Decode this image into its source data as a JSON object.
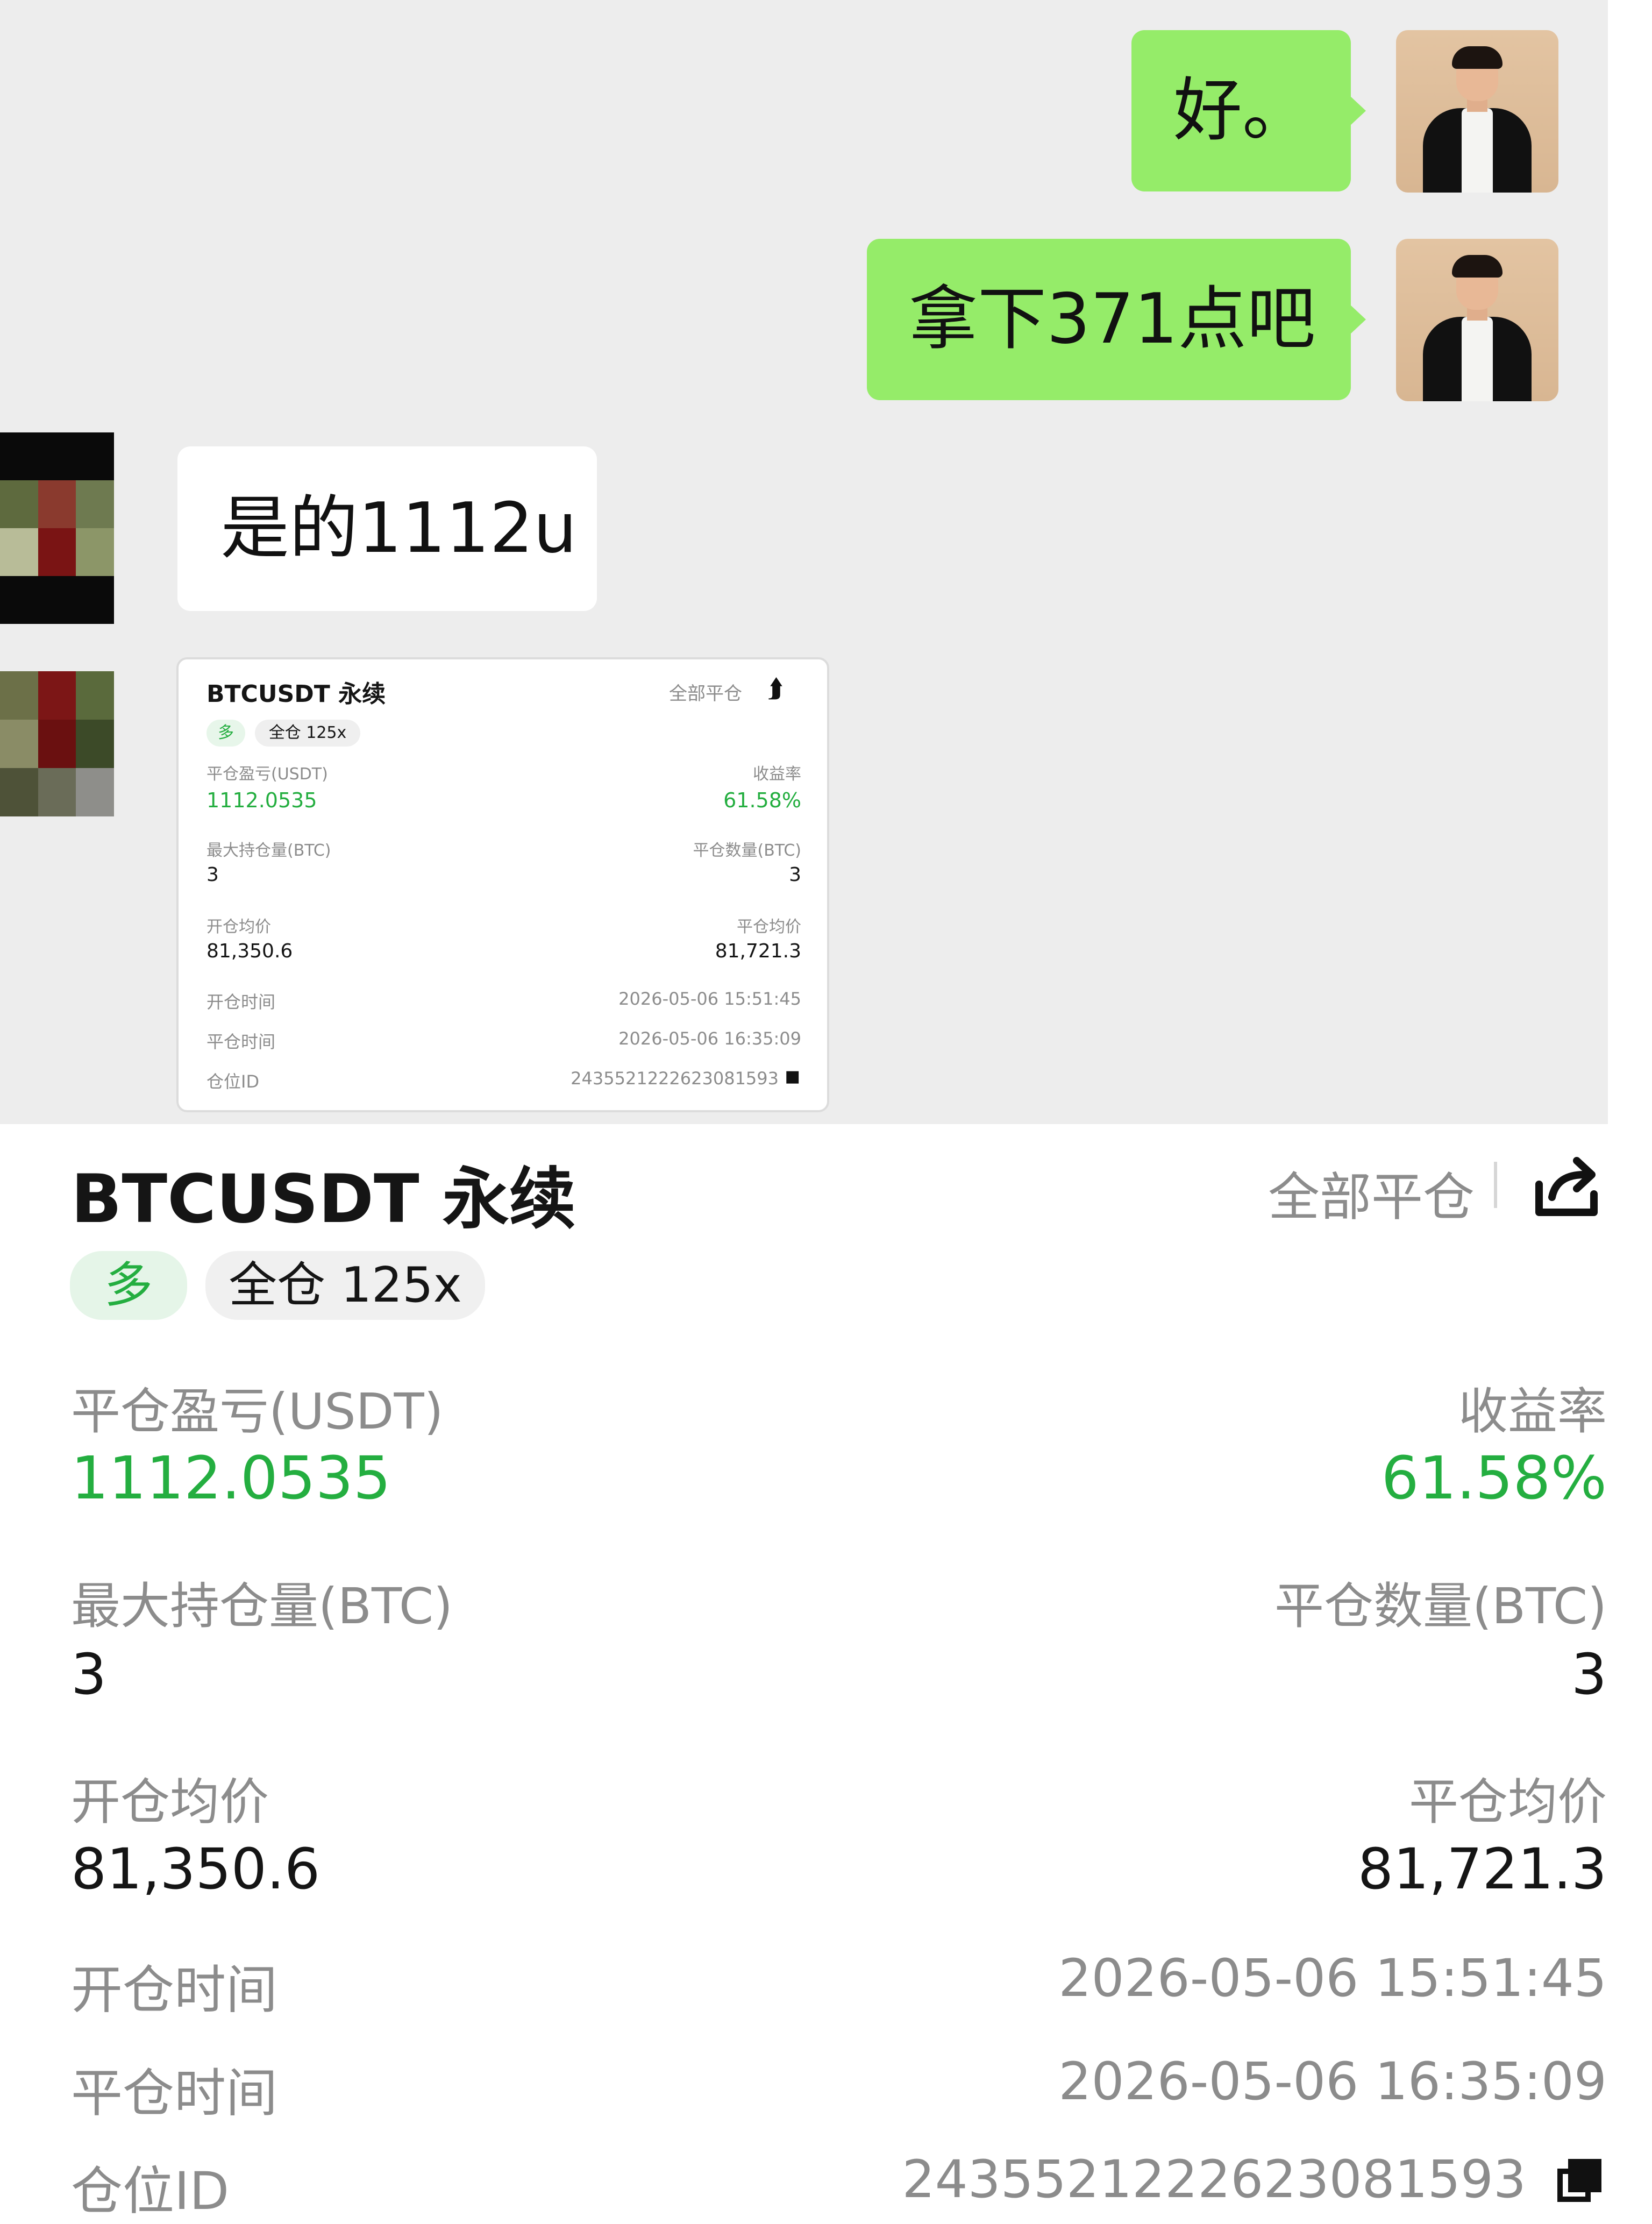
{
  "chat": {
    "messages": [
      {
        "sender": "me",
        "text": "好。"
      },
      {
        "sender": "me",
        "text": "拿下371点吧"
      },
      {
        "sender": "other",
        "text": "是的1112u"
      }
    ],
    "my_bubble_color": "#95ec69",
    "chat_bg": "#ededed"
  },
  "position": {
    "symbol": "BTCUSDT 永续",
    "close_all_label": "全部平仓",
    "share_icon": "share-icon",
    "side_badge": "多",
    "margin_badge": "全仓 125x",
    "pnl_label": "平仓盈亏(USDT)",
    "pnl_value": "1112.0535",
    "roi_label": "收益率",
    "roi_value": "61.58%",
    "max_hold_label": "最大持仓量(BTC)",
    "max_hold_value": "3",
    "close_qty_label": "平仓数量(BTC)",
    "close_qty_value": "3",
    "open_avg_label": "开仓均价",
    "open_avg_value": "81,350.6",
    "close_avg_label": "平仓均价",
    "close_avg_value": "81,721.3",
    "open_time_label": "开仓时间",
    "open_time_value": "2026-05-06 15:51:45",
    "close_time_label": "平仓时间",
    "close_time_value": "2026-05-06 16:35:09",
    "position_id_label": "仓位ID",
    "position_id_value": "2435521222623081593",
    "copy_icon": "copy-icon",
    "accent_green": "#24ae40"
  }
}
